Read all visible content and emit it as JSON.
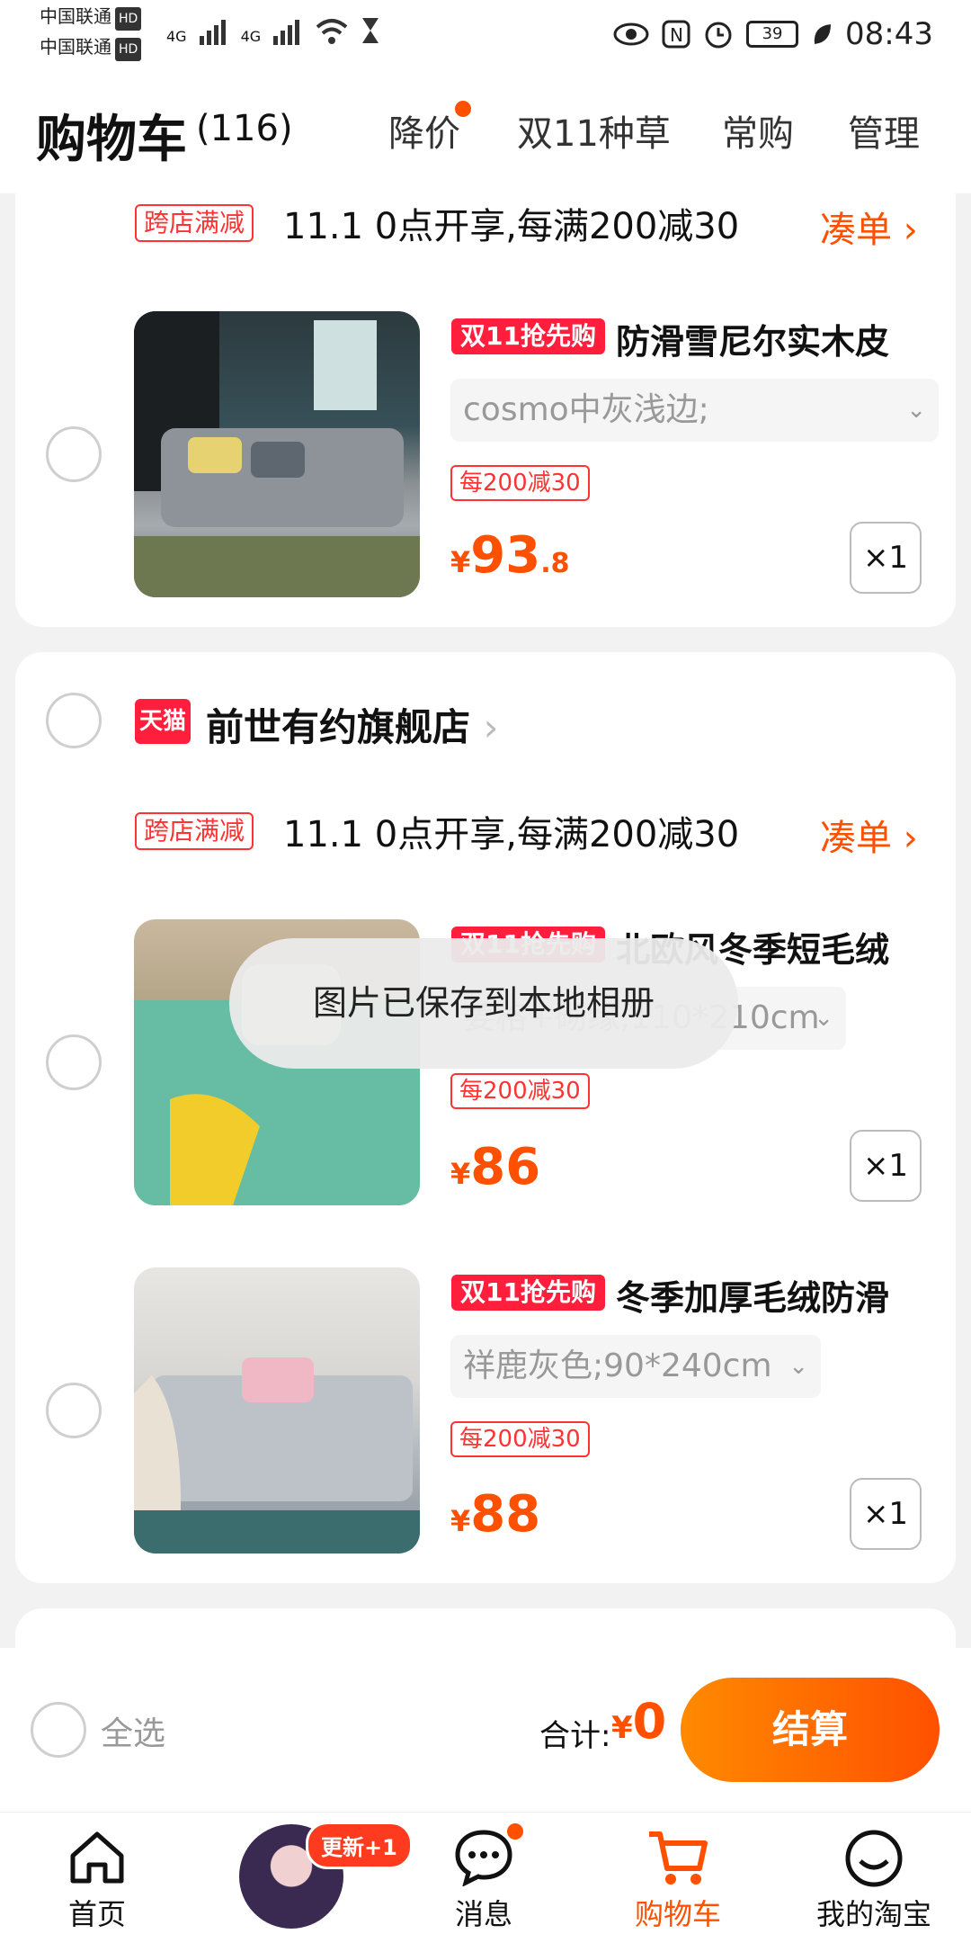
{
  "status_bar": {
    "carrier1": "中国联通",
    "carrier2": "中国联通",
    "hd": "HD",
    "signal": "4G",
    "battery": "39",
    "time": "08:43"
  },
  "header": {
    "title": "购物车",
    "count": "(116)",
    "tabs": [
      "降价",
      "双11种草",
      "常购",
      "管理"
    ]
  },
  "card1": {
    "promo_tag": "跨店满减",
    "promo_text": "11.1 0点开享,每满200减30",
    "addon": "凑单",
    "item": {
      "badge": "双11抢先购",
      "name": "防滑雪尼尔实木皮",
      "sku": "cosmo中灰浅边;",
      "discount": "每200减30",
      "currency": "¥",
      "price_int": "93",
      "price_dec": ".8",
      "qty": "×1"
    }
  },
  "card2": {
    "store_badge": "天猫",
    "store_name": "前世有约旗舰店",
    "promo_tag": "跨店满减",
    "promo_text": "11.1 0点开享,每满200减30",
    "addon": "凑单",
    "items": [
      {
        "badge": "双11抢先购",
        "name": "北欧风冬季短毛绒",
        "sku": "姜格+砌缘;110*210cm",
        "discount": "每200减30",
        "currency": "¥",
        "price_int": "86",
        "qty": "×1"
      },
      {
        "badge": "双11抢先购",
        "name": "冬季加厚毛绒防滑",
        "sku": "祥鹿灰色;90*240cm",
        "discount": "每200减30",
        "currency": "¥",
        "price_int": "88",
        "qty": "×1"
      }
    ]
  },
  "toast": "图片已保存到本地相册",
  "footer": {
    "select_all": "全选",
    "total_label": "合计:",
    "total_currency": "¥",
    "total_value": "0",
    "checkout": "结算"
  },
  "nav": {
    "items": [
      "首页",
      "",
      "消息",
      "购物车",
      "我的淘宝"
    ],
    "update_badge": "更新+1",
    "active_color": "#ff5000"
  }
}
